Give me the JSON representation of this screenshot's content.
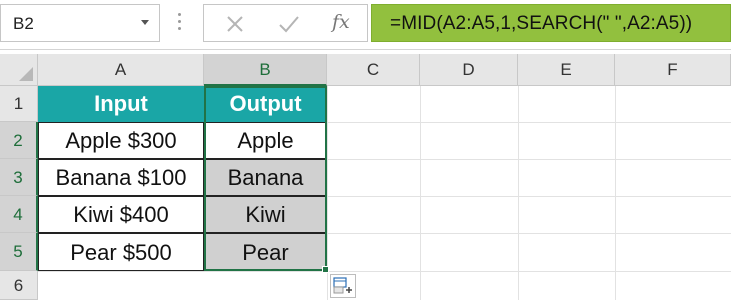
{
  "name_box": {
    "value": "B2"
  },
  "formula_bar": {
    "fx_label": "fx",
    "formula": "=MID(A2:A5,1,SEARCH(\" \",A2:A5))"
  },
  "columns": [
    "A",
    "B",
    "C",
    "D",
    "E",
    "F"
  ],
  "rows": [
    "1",
    "2",
    "3",
    "4",
    "5",
    "6"
  ],
  "table": {
    "headers": {
      "input": "Input",
      "output": "Output"
    },
    "input": [
      "Apple $300",
      "Banana $100",
      "Kiwi $400",
      "Pear $500"
    ],
    "output": [
      "Apple",
      "Banana",
      "Kiwi",
      "Pear"
    ]
  },
  "colors": {
    "header_fill": "#1aa6a6",
    "formula_fill": "#92c03e",
    "selection": "#217346",
    "output_fill": "#d0d0d0"
  },
  "icons": [
    "chevron-down-icon",
    "cancel-x-icon",
    "confirm-check-icon",
    "fx-icon",
    "quick-analysis-icon"
  ]
}
